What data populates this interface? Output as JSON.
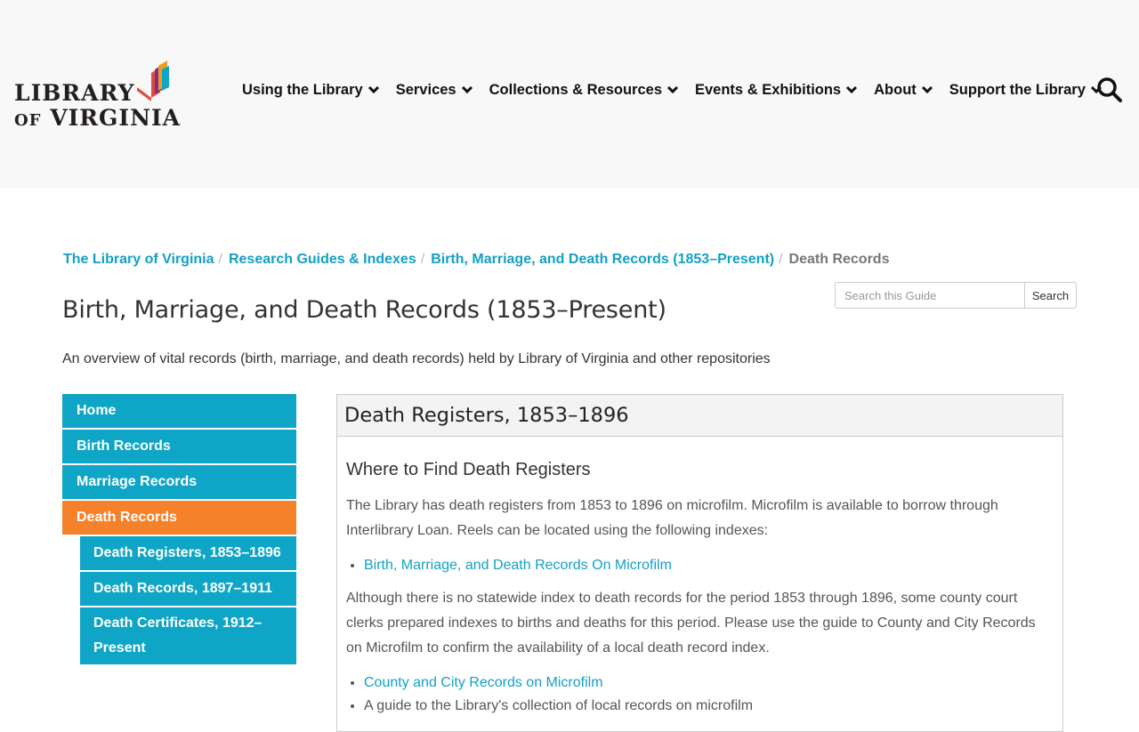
{
  "header": {
    "logo": {
      "line1": "LIBRARY",
      "line2_prefix": "OF",
      "line2_main": "VIRGINIA"
    },
    "nav": [
      {
        "label": "Using the Library",
        "icon": "chevron-down-icon"
      },
      {
        "label": "Services",
        "icon": "chevron-down-icon"
      },
      {
        "label": "Collections & Resources",
        "icon": "chevron-down-icon"
      },
      {
        "label": "Events & Exhibitions",
        "icon": "chevron-down-icon"
      },
      {
        "label": "About",
        "icon": "chevron-down-icon"
      },
      {
        "label": "Support the Library",
        "icon": "chevron-down-icon"
      }
    ],
    "search_icon": "search-icon"
  },
  "breadcrumb": [
    {
      "label": "The Library of Virginia"
    },
    {
      "label": "Research Guides & Indexes"
    },
    {
      "label": "Birth, Marriage, and Death Records (1853–Present)"
    },
    {
      "label": "Death Records"
    }
  ],
  "breadcrumb_separator": "/",
  "guide": {
    "title": "Birth, Marriage, and Death Records (1853–Present)",
    "description": "An overview of vital records (birth, marriage, and death records) held by Library of Virginia and other repositories",
    "search_placeholder": "Search this Guide",
    "search_button": "Search"
  },
  "sidebar": {
    "items": [
      {
        "label": "Home"
      },
      {
        "label": "Birth Records"
      },
      {
        "label": "Marriage Records"
      },
      {
        "label": "Death Records",
        "active": true
      }
    ],
    "subitems": [
      {
        "label": "Death Registers, 1853–1896"
      },
      {
        "label": "Death Records, 1897–1911"
      },
      {
        "label": "Death Certificates, 1912–Present"
      }
    ]
  },
  "content": {
    "box_title": "Death Registers, 1853–1896",
    "heading": "Where to Find Death Registers",
    "para1": "The Library has death registers from 1853 to 1896 on microfilm. Microfilm is available to borrow through Interlibrary Loan. Reels can be located using the following indexes:",
    "link1": "Birth, Marriage, and Death Records On Microfilm",
    "para2": "Although there is no statewide index to death records for the period 1853 through 1896, some county court clerks prepared indexes to births and deaths for this period. Please use the guide to County and City Records on Microfilm to confirm the availability of a local death record index.",
    "link2": "County and City Records on Microfilm",
    "link3": "A guide to the Library's collection of local records on microfilm"
  },
  "colors": {
    "accent_blue": "#0ea5c6",
    "link_blue": "#14a0c5",
    "active_orange": "#f5822a",
    "header_bg": "#f8f8f8"
  }
}
